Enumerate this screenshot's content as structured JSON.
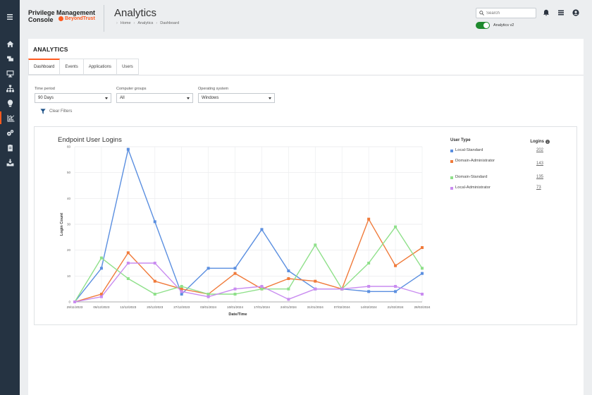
{
  "header": {
    "brand_line1": "Privilege Management",
    "brand_line2": "Console",
    "brand_logo": "BeyondTrust",
    "page_title": "Analytics",
    "breadcrumb": [
      "Home",
      "Analytics",
      "Dashboard"
    ],
    "search_placeholder": "Search",
    "toggle_label": "Analytics v2",
    "toggle_on": true,
    "icons": [
      "bell-icon",
      "grid-icon",
      "user-circle-icon"
    ]
  },
  "rail": {
    "items": [
      "menu-icon",
      "home-icon",
      "computer-group-icon",
      "monitor-icon",
      "hierarchy-icon",
      "lightbulb-icon",
      "analytics-icon",
      "gears-icon",
      "clipboard-icon",
      "inbox-download-icon"
    ],
    "active": "analytics-icon"
  },
  "section_title": "ANALYTICS",
  "tabs": [
    {
      "label": "Dashboard",
      "active": true
    },
    {
      "label": "Events",
      "active": false
    },
    {
      "label": "Applications",
      "active": false
    },
    {
      "label": "Users",
      "active": false
    }
  ],
  "filters": [
    {
      "label": "Time period",
      "value": "90 Days"
    },
    {
      "label": "Computer groups",
      "value": "All"
    },
    {
      "label": "Operating system",
      "value": "Windows"
    }
  ],
  "clear_filters_label": "Clear Filters",
  "legend": {
    "type_header": "User Type",
    "logins_header": "Logins",
    "rows": [
      {
        "name": "Local-Standard",
        "value": "202"
      },
      {
        "name": "Domain-Administrator",
        "value": "143"
      },
      {
        "name": "Domain-Standard",
        "value": "135"
      },
      {
        "name": "Local-Administrator",
        "value": "73"
      }
    ]
  },
  "chart_data": {
    "type": "line",
    "title": "Endpoint User Logins",
    "xlabel": "Date/Time",
    "ylabel": "Login Count",
    "ylim": [
      0,
      60
    ],
    "yticks": [
      0,
      10,
      20,
      30,
      40,
      50,
      60
    ],
    "grid": true,
    "legend_position": "right",
    "categories": [
      "29/11/2023",
      "06/12/2023",
      "13/12/2023",
      "20/12/2023",
      "27/12/2023",
      "03/01/2024",
      "10/01/2024",
      "17/01/2024",
      "24/01/2024",
      "31/01/2024",
      "07/02/2024",
      "14/02/2024",
      "21/02/2024",
      "28/02/2024"
    ],
    "series": [
      {
        "name": "Local-Standard",
        "color": "#5b8fe0",
        "values": [
          0,
          13,
          59,
          31,
          3,
          13,
          13,
          28,
          12,
          5,
          5,
          4,
          4,
          11
        ]
      },
      {
        "name": "Domain-Administrator",
        "color": "#f07a3a",
        "values": [
          0,
          3,
          19,
          8,
          5,
          3,
          11,
          5,
          9,
          8,
          5,
          32,
          14,
          21
        ]
      },
      {
        "name": "Domain-Standard",
        "color": "#8fe08a",
        "values": [
          0,
          17,
          9,
          3,
          6,
          3,
          3,
          5,
          5,
          22,
          5,
          15,
          29,
          13
        ]
      },
      {
        "name": "Local-Administrator",
        "color": "#c98cf0",
        "values": [
          0,
          2,
          15,
          15,
          4,
          2,
          5,
          6,
          1,
          5,
          5,
          6,
          6,
          3
        ]
      }
    ]
  }
}
